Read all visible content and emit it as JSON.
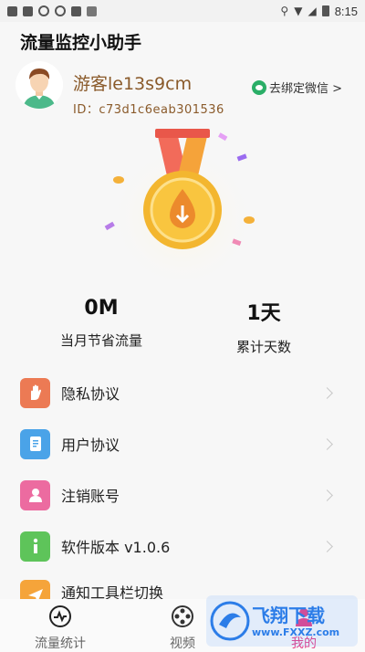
{
  "status_bar": {
    "time": "8:15"
  },
  "app_title": "流量监控小助手",
  "profile": {
    "username": "游客le13s9cm",
    "user_id": "ID：c73d1c6eab301536",
    "bind_wechat": "去绑定微信 >"
  },
  "stats": [
    {
      "value": "0M",
      "label": "当月节省流量"
    },
    {
      "value": "1天",
      "label": "累计天数"
    }
  ],
  "menu": [
    {
      "label": "隐私协议",
      "icon": "hand-icon",
      "color": "#ec7a54"
    },
    {
      "label": "用户协议",
      "icon": "document-icon",
      "color": "#4aa3e8"
    },
    {
      "label": "注销账号",
      "icon": "user-icon",
      "color": "#ec6ba0"
    },
    {
      "label": "软件版本  v1.0.6",
      "icon": "info-icon",
      "color": "#5ec45a"
    },
    {
      "label": "通知工具栏切换",
      "icon": "paper-plane-icon",
      "color": "#f5a43a"
    }
  ],
  "bottom_nav": [
    {
      "label": "流量统计",
      "icon": "gauge-icon"
    },
    {
      "label": "视频",
      "icon": "film-reel-icon"
    },
    {
      "label": "我的",
      "icon": "user-icon",
      "active": true
    }
  ],
  "watermark": {
    "title": "飞翔下载",
    "url": "www.FXXZ.com"
  }
}
